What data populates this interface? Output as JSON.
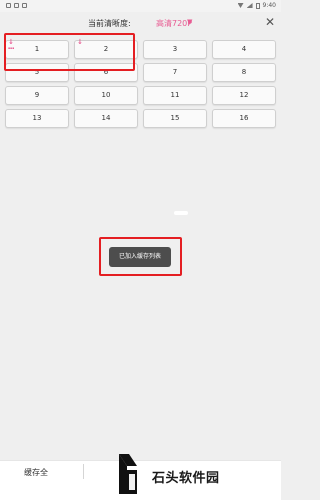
{
  "status_bar": {
    "time": "9:40"
  },
  "header": {
    "label": "当前清晰度:",
    "quality": "高清720P",
    "chevron": "▼",
    "close": "✕"
  },
  "episodes": [
    "1",
    "2",
    "3",
    "4",
    "5",
    "6",
    "7",
    "8",
    "9",
    "10",
    "11",
    "12",
    "13",
    "14",
    "15",
    "16"
  ],
  "downloaded": [
    "1",
    "2"
  ],
  "toast": "已加入缓存列表",
  "bottom": {
    "cache_all": "缓存全"
  },
  "watermark": {
    "text": "石头软件园"
  },
  "colors": {
    "accent": "#e85b92",
    "highlight": "#e41e22",
    "toast_bg": "#4d4d4d"
  }
}
